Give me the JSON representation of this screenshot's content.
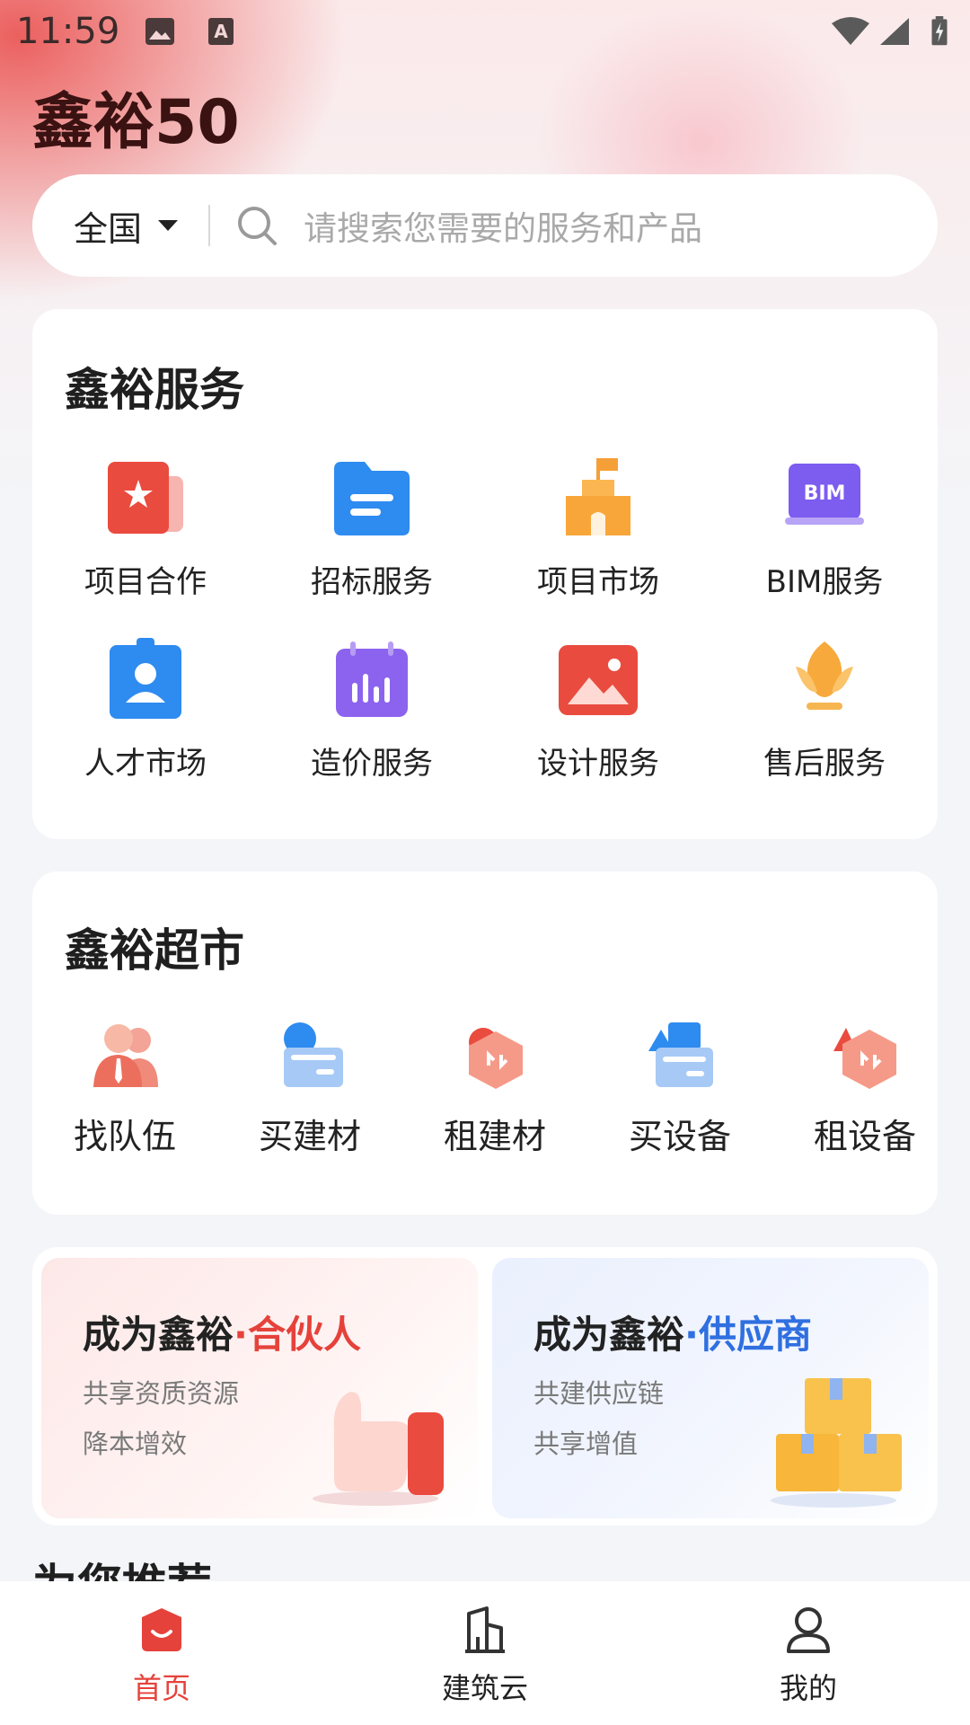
{
  "status_bar": {
    "time": "11:59",
    "icons": [
      "image-icon",
      "font-a-icon",
      "wifi-icon",
      "signal-icon",
      "battery-icon"
    ]
  },
  "app": {
    "title": "鑫裕50"
  },
  "search": {
    "region": "全国",
    "placeholder": "请搜索您需要的服务和产品"
  },
  "services": {
    "title": "鑫裕服务",
    "items": [
      {
        "label": "项目合作",
        "icon": "star-folder-icon"
      },
      {
        "label": "招标服务",
        "icon": "file-folder-icon"
      },
      {
        "label": "项目市场",
        "icon": "castle-flag-icon"
      },
      {
        "label": "BIM服务",
        "icon": "bim-monitor-icon",
        "icon_text": "BIM"
      },
      {
        "label": "人才市场",
        "icon": "badge-person-icon"
      },
      {
        "label": "造价服务",
        "icon": "calendar-chart-icon"
      },
      {
        "label": "设计服务",
        "icon": "picture-icon"
      },
      {
        "label": "售后服务",
        "icon": "hand-flower-icon"
      }
    ]
  },
  "market": {
    "title": "鑫裕超市",
    "items": [
      {
        "label": "找队伍",
        "icon": "team-icon"
      },
      {
        "label": "买建材",
        "icon": "buy-material-icon"
      },
      {
        "label": "租建材",
        "icon": "rent-material-icon"
      },
      {
        "label": "买设备",
        "icon": "buy-equipment-icon"
      },
      {
        "label": "租设备",
        "icon": "rent-equipment-icon"
      }
    ]
  },
  "promos": [
    {
      "title_prefix": "成为鑫裕",
      "title_highlight": "合伙人",
      "lines": [
        "共享资质资源",
        "降本增效"
      ],
      "art": "thumbs-up-icon"
    },
    {
      "title_prefix": "成为鑫裕",
      "title_highlight": "供应商",
      "lines": [
        "共建供应链",
        "共享增值"
      ],
      "art": "boxes-icon"
    }
  ],
  "recommend": {
    "title": "为您推荐"
  },
  "bottom_nav": [
    {
      "label": "首页",
      "icon": "home-icon",
      "active": true
    },
    {
      "label": "建筑云",
      "icon": "building-icon",
      "active": false
    },
    {
      "label": "我的",
      "icon": "user-icon",
      "active": false
    }
  ],
  "colors": {
    "accent": "#e5423b",
    "blue_accent": "#2f6fe0",
    "title_dark": "#3b1212"
  }
}
